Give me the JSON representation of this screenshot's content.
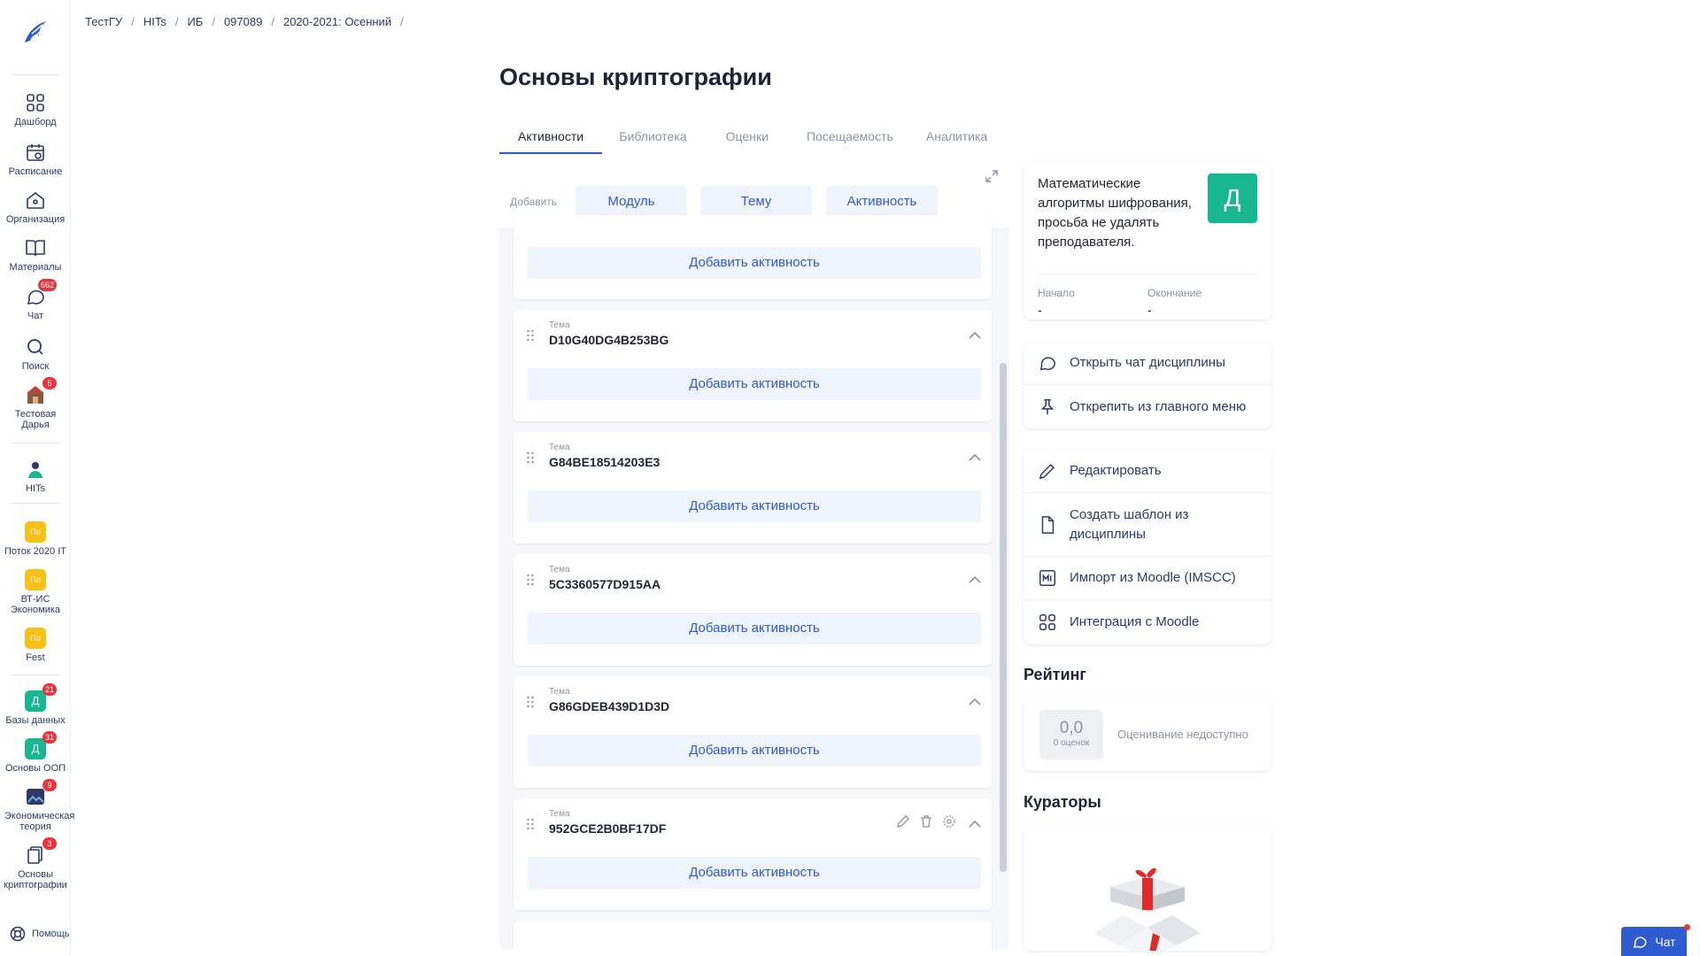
{
  "breadcrumb": [
    "ТестГУ",
    "HITs",
    "ИБ",
    "097089",
    "2020-2021: Осенний"
  ],
  "title": "Основы криптографии",
  "tabs": [
    "Активности",
    "Библиотека",
    "Оценки",
    "Посещаемость",
    "Аналитика"
  ],
  "sidebar": {
    "items": [
      {
        "label": "Дашборд"
      },
      {
        "label": "Расписание"
      },
      {
        "label": "Организация"
      },
      {
        "label": "Материалы"
      },
      {
        "label": "Чат",
        "badge": "662"
      },
      {
        "label": "Поиск"
      },
      {
        "label": "Тестовая Дарья",
        "badge": "5"
      },
      {
        "label": "HITs"
      },
      {
        "label": "Поток 2020 IT",
        "tile": "По"
      },
      {
        "label": "ВТ-ИС Экономика",
        "tile": "По"
      },
      {
        "label": "Fest",
        "tile": "По"
      },
      {
        "label": "Базы данных",
        "tile": "Д",
        "badge": "21"
      },
      {
        "label": "Основы ООП",
        "tile": "Д",
        "badge": "31"
      },
      {
        "label": "Экономическая теория",
        "badge": "9"
      },
      {
        "label": "Основы криптографии",
        "badge": "3"
      }
    ],
    "help": "Помощь"
  },
  "toolbar": {
    "add_label": "Добавить",
    "module": "Модуль",
    "topic": "Тему",
    "activity": "Активность"
  },
  "add_activity": "Добавить активность",
  "topic_kind": "Тема",
  "topics": [
    "D10G40DG4B253BG",
    "G84BE18514203E3",
    "5C3360577D915AA",
    "G86GDEB439D1D3D",
    "952GCE2B0BF17DF"
  ],
  "info": {
    "description": "Математические алгоритмы шифрования, просьба не удалять преподавателя.",
    "avatar_letter": "Д",
    "start_label": "Начало",
    "start_value": "-",
    "end_label": "Окончание",
    "end_value": "-"
  },
  "menu1": [
    "Открыть чат дисциплины",
    "Открепить из главного меню"
  ],
  "menu2": [
    "Редактировать",
    "Создать шаблон из дисциплины",
    "Импорт из Moodle (IMSCC)",
    "Интеграция с Moodle"
  ],
  "rating": {
    "title": "Рейтинг",
    "value": "0,0",
    "count": "0 оценок",
    "status": "Оценивание недоступно"
  },
  "curators_title": "Кураторы",
  "chat_button": "Чат",
  "colors": {
    "accent": "#2f5bd0",
    "green": "#19b78f",
    "badge": "#e8353b",
    "yellow": "#f7c215"
  }
}
